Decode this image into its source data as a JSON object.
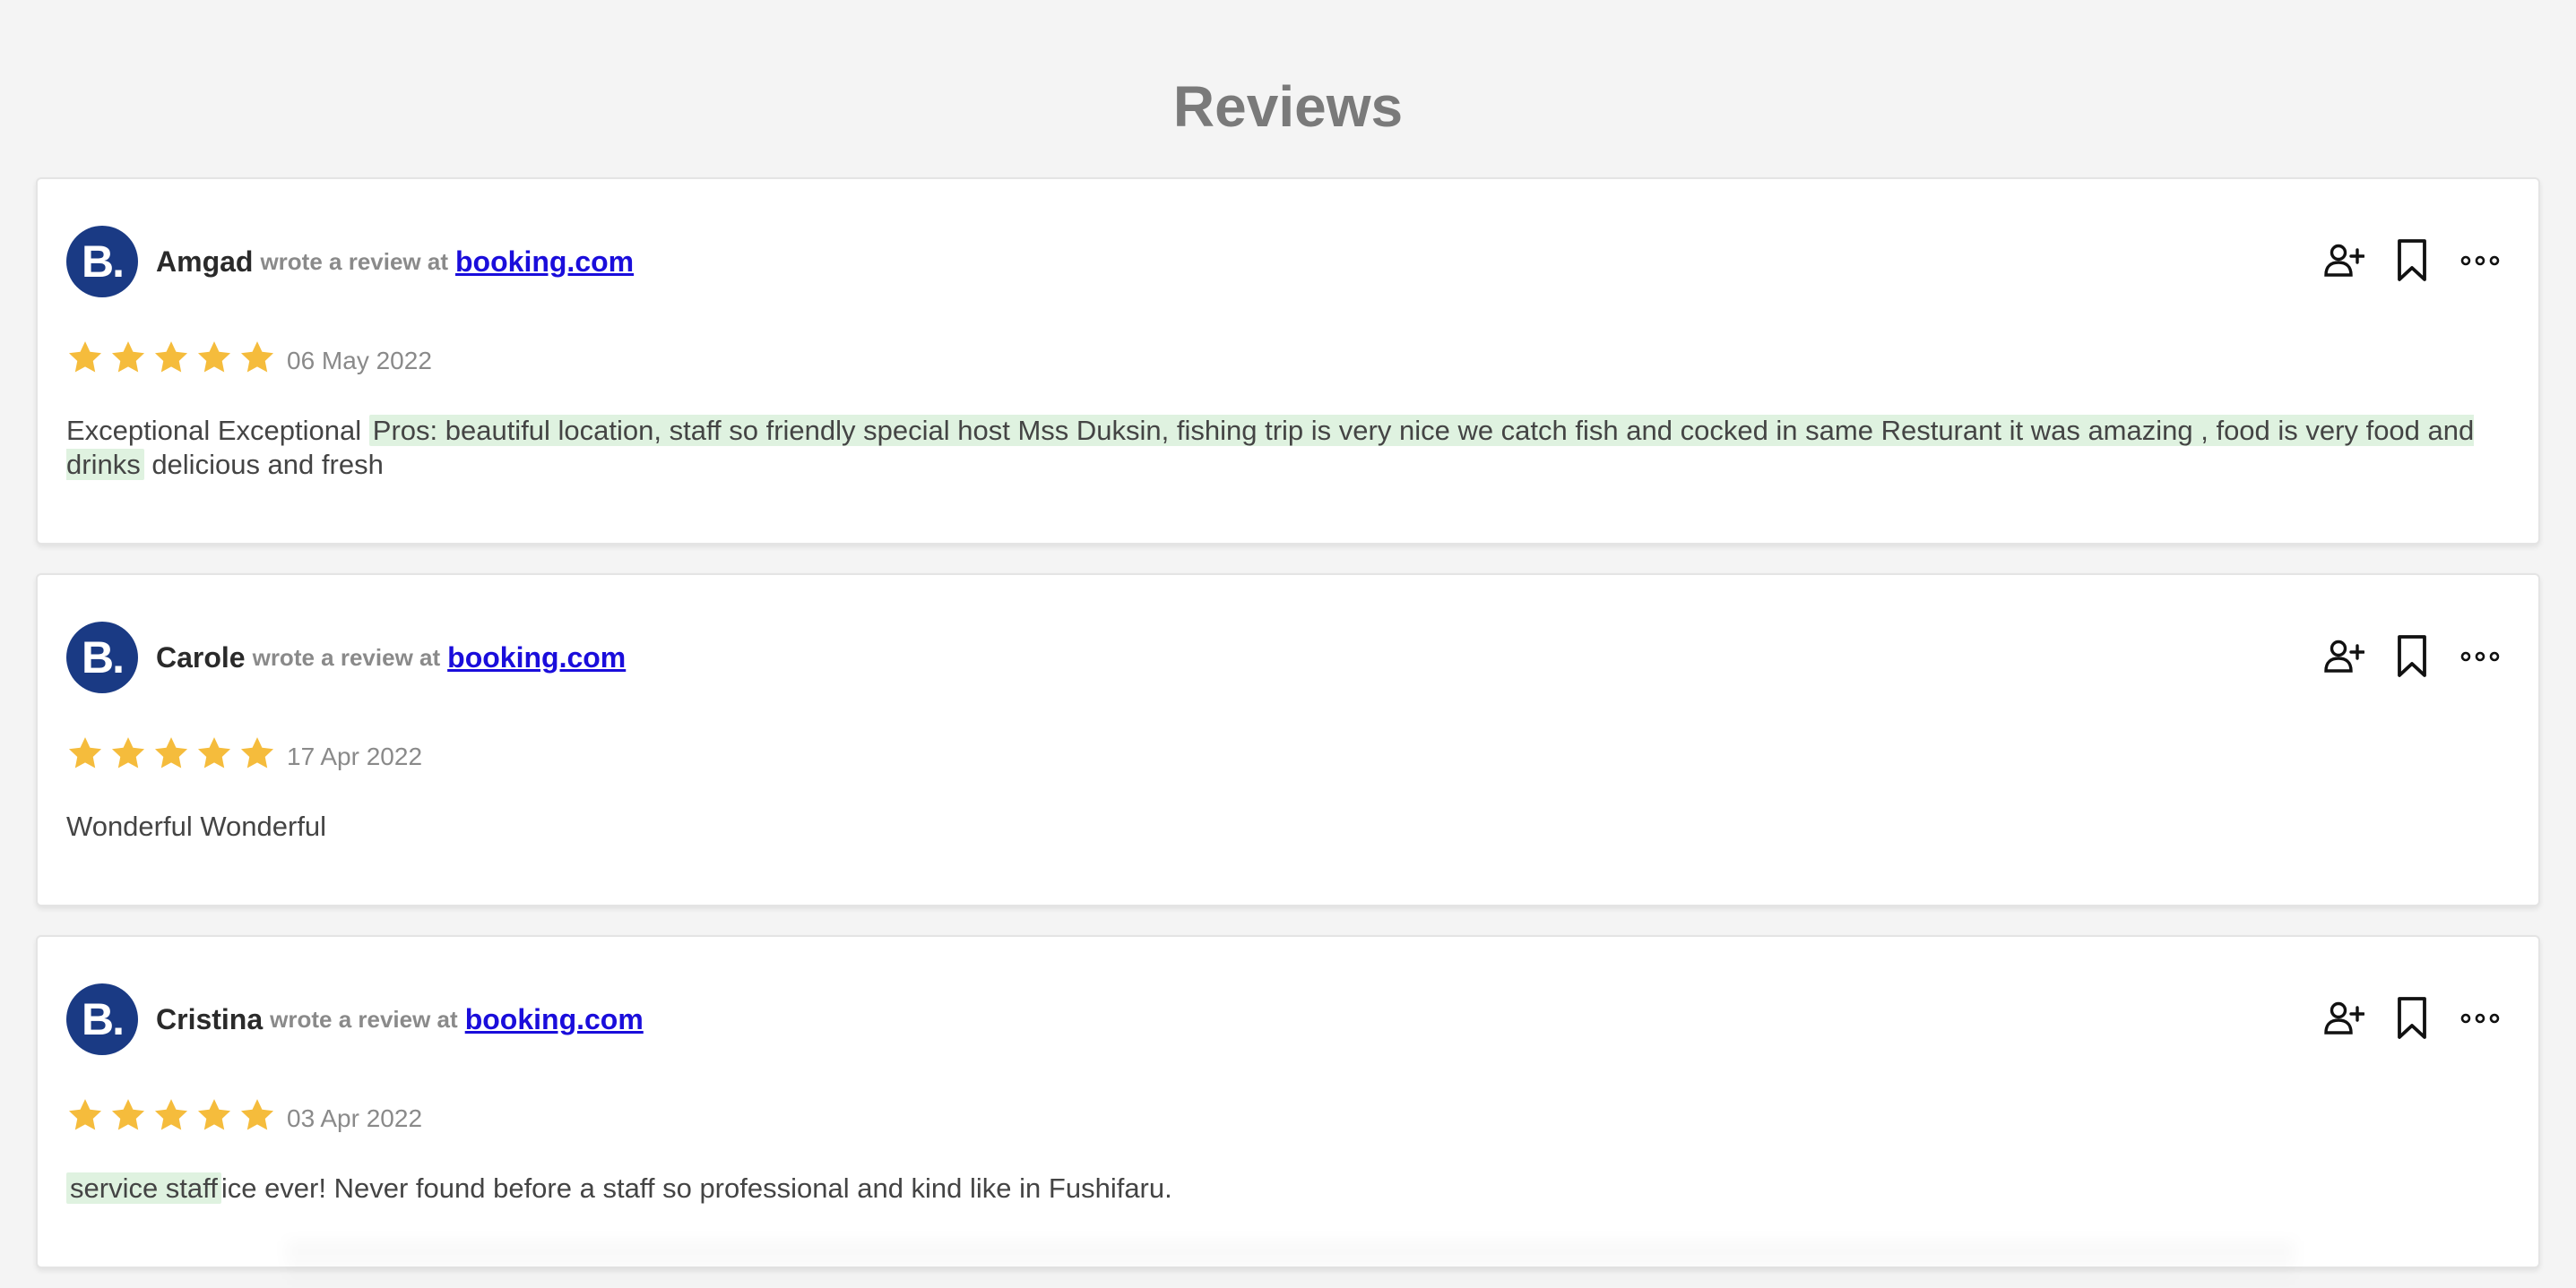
{
  "page": {
    "title": "Reviews"
  },
  "colors": {
    "avatar_bg": "#1a3a84",
    "star": "#f5bc3c",
    "link": "#1a0ddb",
    "highlight": "#dff2e0"
  },
  "icons": {
    "avatar": "booking-logo-icon",
    "star": "star-icon",
    "follow": "add-user-icon",
    "bookmark": "bookmark-icon",
    "more": "more-options-icon"
  },
  "reviews": [
    {
      "avatar_letter": "B.",
      "name": "Amgad",
      "wrote": "wrote a review at",
      "source": "booking.com",
      "rating": 5,
      "date": "06 May 2022",
      "text": {
        "before": "Exceptional Exceptional ",
        "highlight": "Pros: beautiful location, staff so friendly special host Mss Duksin, fishing trip is very nice we catch fish and cocked in same Resturant it was amazing , food is very food and drinks",
        "after": " delicious and fresh"
      }
    },
    {
      "avatar_letter": "B.",
      "name": "Carole",
      "wrote": "wrote a review at",
      "source": "booking.com",
      "rating": 5,
      "date": "17 Apr 2022",
      "text": {
        "before": "Wonderful Wonderful",
        "highlight": "",
        "after": ""
      }
    },
    {
      "avatar_letter": "B.",
      "name": "Cristina",
      "wrote": "wrote a review at",
      "source": "booking.com",
      "rating": 5,
      "date": "03 Apr 2022",
      "text": {
        "before": "",
        "highlight": "service staff",
        "after": "ice ever! Never found before a staff so professional and kind like in Fushifaru."
      }
    }
  ]
}
